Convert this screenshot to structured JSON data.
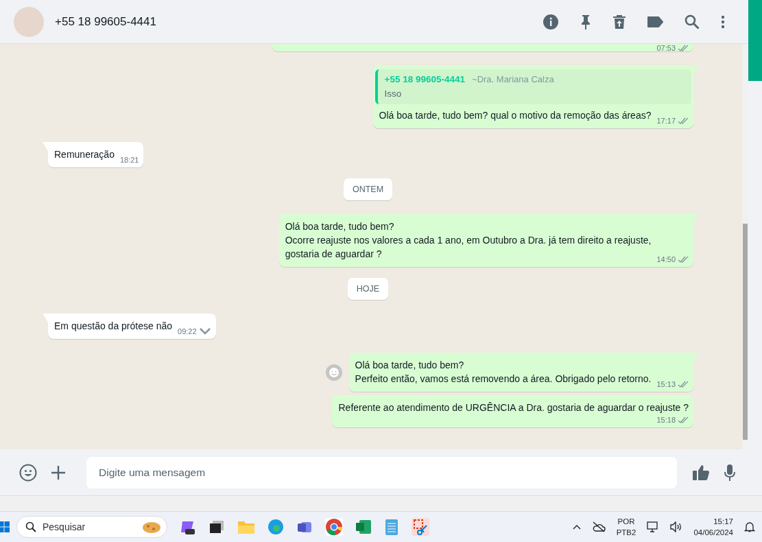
{
  "header": {
    "contact": "+55 18 99605-4441"
  },
  "messages": [
    {
      "kind": "out",
      "tail": false,
      "cut": true,
      "time": "07:53",
      "read": false
    },
    {
      "kind": "out",
      "tail": true,
      "quote": {
        "author": "+55 18 99605-4441",
        "name": "~Dra. Mariana Calza",
        "text": "Isso"
      },
      "lines": [
        "Olá boa tarde, tudo bem? qual o motivo da remoção das áreas?"
      ],
      "time": "17:17",
      "read": false
    },
    {
      "kind": "in",
      "tail": true,
      "lines": [
        "Remuneração"
      ],
      "time": "18:21"
    },
    {
      "kind": "date",
      "label": "ONTEM"
    },
    {
      "kind": "out",
      "tail": true,
      "lines": [
        "Olá boa tarde, tudo bem?",
        "Ocorre reajuste nos valores a cada 1 ano, em Outubro a Dra. já tem direito a reajuste,",
        "gostaria de aguardar ?"
      ],
      "time": "14:50",
      "read": false
    },
    {
      "kind": "date",
      "label": "HOJE"
    },
    {
      "kind": "in",
      "tail": true,
      "lines": [
        "Em questão da prótese não"
      ],
      "time": "09:22",
      "menu": true
    },
    {
      "kind": "out",
      "tail": true,
      "react": true,
      "lines": [
        "Olá boa tarde, tudo bem?",
        "Perfeito então, vamos está removendo a área. Obrigado pelo retorno."
      ],
      "time": "15:13",
      "read": false
    },
    {
      "kind": "out",
      "tail": false,
      "lines": [
        "Referente ao atendimento de URGÊNCIA a Dra. gostaria de aguardar o reajuste ?"
      ],
      "time": "15:18",
      "read": false,
      "time_below": true
    }
  ],
  "composer": {
    "placeholder": "Digite uma mensagem"
  },
  "taskbar": {
    "search_placeholder": "Pesquisar",
    "language": "POR",
    "layout": "PTB2",
    "time": "15:17",
    "date": "04/06/2024"
  }
}
